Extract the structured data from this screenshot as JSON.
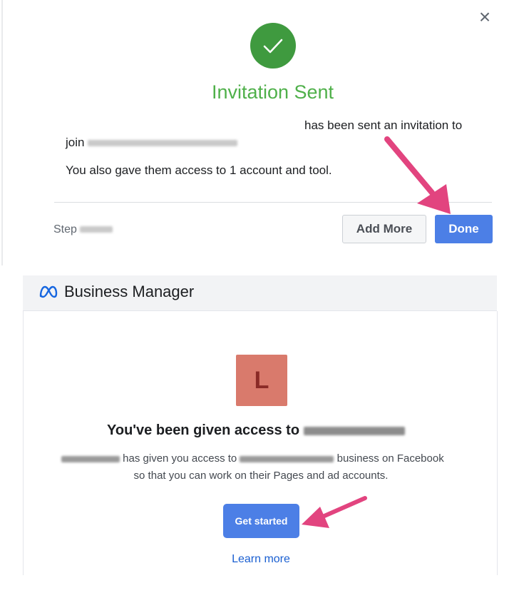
{
  "dialog": {
    "close_glyph": "×",
    "title": "Invitation Sent",
    "line1": "has been sent an invitation to",
    "line2_prefix": "join",
    "line3": "You also gave them access to 1 account and tool.",
    "step_label": "Step",
    "add_more_label": "Add More",
    "done_label": "Done",
    "success_color": "#4fb04a"
  },
  "business_manager": {
    "app_name": "Business Manager",
    "avatar_letter": "L",
    "access_title_prefix": "You've been given access to",
    "desc_part1": "has given you access to",
    "desc_part2": "business on Facebook",
    "desc_line2": "so that you can work on their Pages and ad accounts.",
    "get_started_label": "Get started",
    "learn_more_label": "Learn more",
    "accent_color": "#4c7fe6",
    "avatar_color": "#d97a6c"
  },
  "annotations": {
    "arrow_color": "#e2447f"
  }
}
